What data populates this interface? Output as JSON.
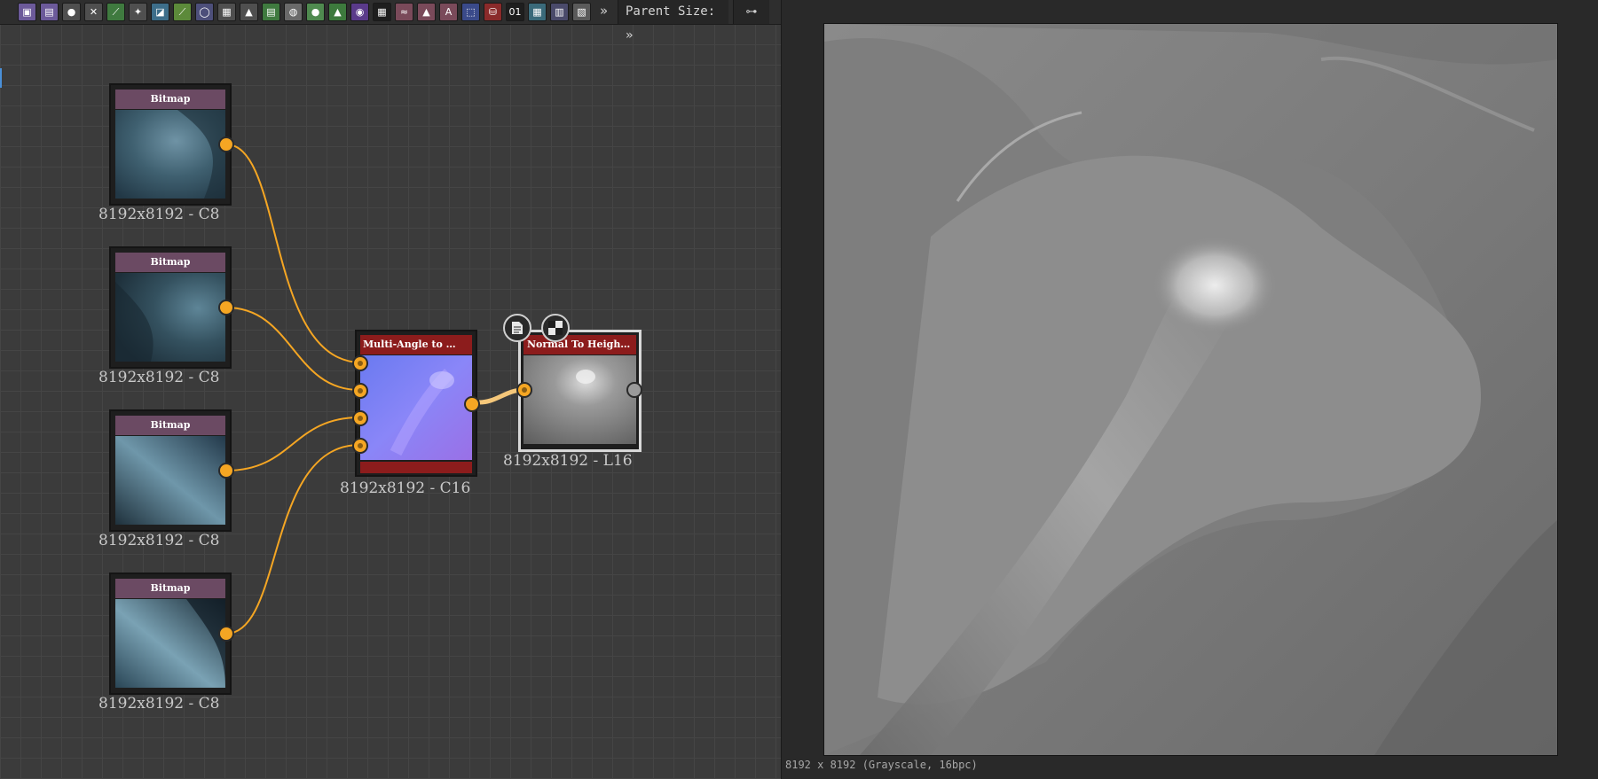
{
  "toolbar": {
    "icons": [
      {
        "name": "bitmap-icon",
        "color": "#6c5a9a"
      },
      {
        "name": "svg-icon",
        "color": "#6c5a9a"
      },
      {
        "name": "uniform-color-icon",
        "color": "#4f4f4f"
      },
      {
        "name": "transform-icon",
        "color": "#4f4f4f"
      },
      {
        "name": "curve-icon",
        "color": "#3f7a3f"
      },
      {
        "name": "levels-icon",
        "color": "#4f4f4f"
      },
      {
        "name": "blend-icon",
        "color": "#3d6e8a"
      },
      {
        "name": "gradient-map-icon",
        "color": "#5c8a3a"
      },
      {
        "name": "shape-icon",
        "color": "#4d4f7a"
      },
      {
        "name": "tile-generator-icon",
        "color": "#4f4f4f"
      },
      {
        "name": "fill-icon",
        "color": "#4f4f4f"
      },
      {
        "name": "warp-icon",
        "color": "#3f7a3f"
      },
      {
        "name": "blur-icon",
        "color": "#6a6a6a"
      },
      {
        "name": "sharpen-icon",
        "color": "#4f8a4f"
      },
      {
        "name": "hsl-icon",
        "color": "#3d7a3d"
      },
      {
        "name": "color-wheel-icon",
        "color": "#5a3a8a"
      },
      {
        "name": "noise-icon",
        "color": "#1e1e1e"
      },
      {
        "name": "directional-warp-icon",
        "color": "#7a4a5a"
      },
      {
        "name": "emboss-icon",
        "color": "#7a4a5a"
      },
      {
        "name": "text-icon",
        "color": "#7a4a5a"
      },
      {
        "name": "crop-icon",
        "color": "#3a4a8a"
      },
      {
        "name": "paint-bucket-icon",
        "color": "#8a2a2a"
      },
      {
        "name": "pixel-processor-icon",
        "color": "#1e1e1e"
      },
      {
        "name": "fx-map-icon",
        "color": "#3a6a7a"
      },
      {
        "name": "graph-icon",
        "color": "#4a4a6a"
      },
      {
        "name": "output-icon",
        "color": "#5a5a5a"
      }
    ],
    "more": "»",
    "parent_size_label": "Parent Size:",
    "parent_size_more": "»",
    "graph_options": "⊶"
  },
  "nodes": {
    "bitmaps": [
      {
        "title": "Bitmap",
        "caption": "8192x8192 - C8"
      },
      {
        "title": "Bitmap",
        "caption": "8192x8192 - C8"
      },
      {
        "title": "Bitmap",
        "caption": "8192x8192 - C8"
      },
      {
        "title": "Bitmap",
        "caption": "8192x8192 - C8"
      }
    ],
    "multi_angle": {
      "title": "Multi-Angle to …",
      "caption": "8192x8192 - C16"
    },
    "normal_to_height": {
      "title": "Normal To Heigh…",
      "caption": "8192x8192 - L16"
    }
  },
  "colors": {
    "port": "#f5a623",
    "wire": "#f5a623",
    "bitmap_header": "#6b4a63",
    "node_header_red": "#8c1c1c"
  },
  "preview": {
    "status": "8192 x 8192 (Grayscale, 16bpc)"
  }
}
